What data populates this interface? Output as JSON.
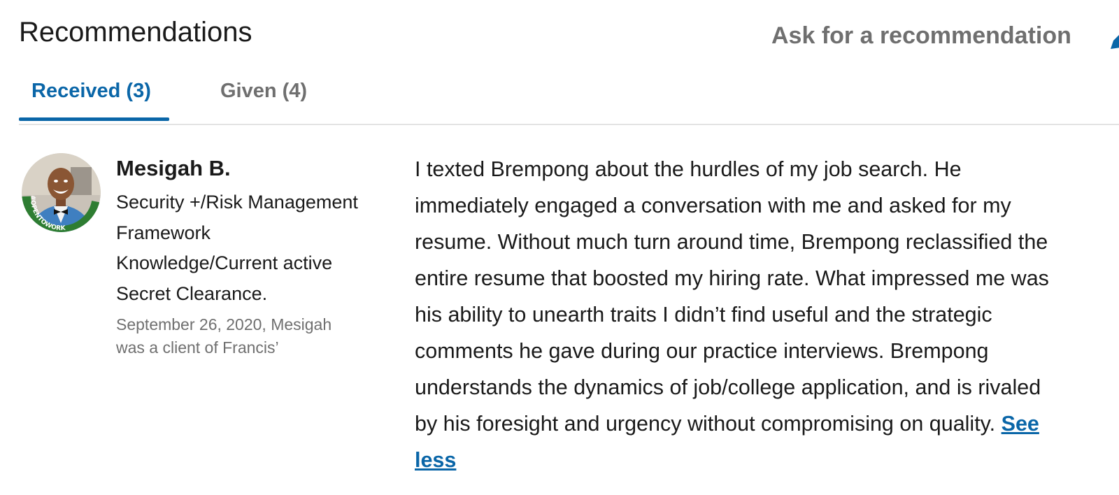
{
  "section": {
    "title": "Recommendations",
    "ask_label": "Ask for a recommendation"
  },
  "tabs": [
    {
      "label": "Received (3)",
      "active": true
    },
    {
      "label": "Given (4)",
      "active": false
    }
  ],
  "recommendation": {
    "name": "Mesigah B.",
    "headline_lines": [
      "Security +/Risk Management",
      "Framework",
      "Knowledge/Current active",
      "Secret Clearance."
    ],
    "meta_lines": [
      "September 26, 2020, Mesigah",
      "was a client of Francis’"
    ],
    "avatar_badge": "#OPENTOWORK",
    "text_lines": [
      "I texted Brempong about the hurdles of my job search. He",
      "immediately engaged a conversation with me and asked for my",
      "resume. Without much turn around time, Brempong reclassified the",
      "entire resume that boosted my hiring rate. What impressed me was",
      "his ability to unearth traits I didn’t find useful and the strategic",
      "comments he gave during our practice interviews. Brempong",
      "understands the dynamics of job/college application, and is rivaled",
      "by his foresight and urgency without compromising on quality. "
    ],
    "see_less_first": "See",
    "see_less_second": "less"
  },
  "colors": {
    "accent": "#0a66a8",
    "muted": "#6f6f6f",
    "text": "#1a1a1a",
    "badge_green": "#2e7d32"
  },
  "icons": {
    "edit": "pencil-icon"
  }
}
